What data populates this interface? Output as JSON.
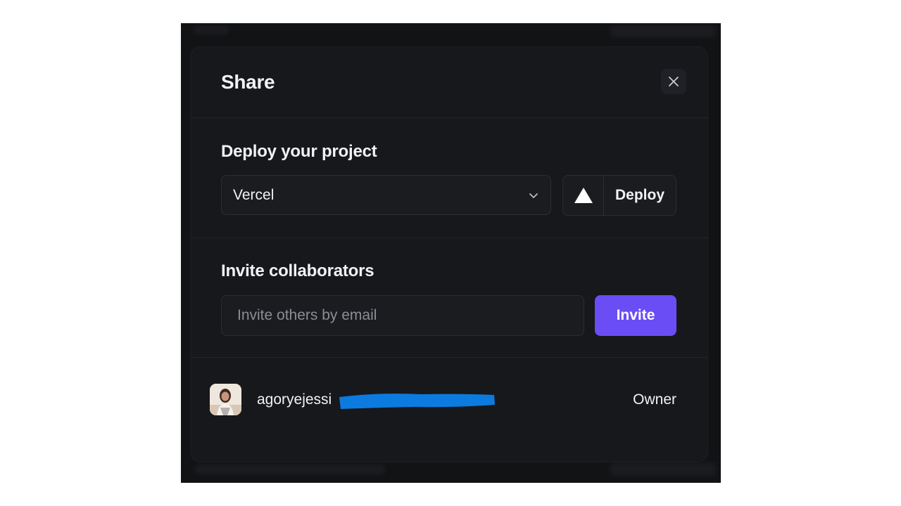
{
  "modal": {
    "title": "Share",
    "close_icon": "close-icon"
  },
  "deploy": {
    "title": "Deploy your project",
    "provider_selected": "Vercel",
    "provider_icon": "chevron-down-icon",
    "button_icon": "vercel-triangle-icon",
    "button_label": "Deploy"
  },
  "invite": {
    "title": "Invite collaborators",
    "email_placeholder": "Invite others by email",
    "email_value": "",
    "button_label": "Invite"
  },
  "members": [
    {
      "email_visible": "agoryejessi",
      "email_redacted": true,
      "role": "Owner"
    }
  ],
  "colors": {
    "accent": "#6a4df4",
    "modal_bg": "#17181c",
    "redaction": "#0b7be0"
  }
}
